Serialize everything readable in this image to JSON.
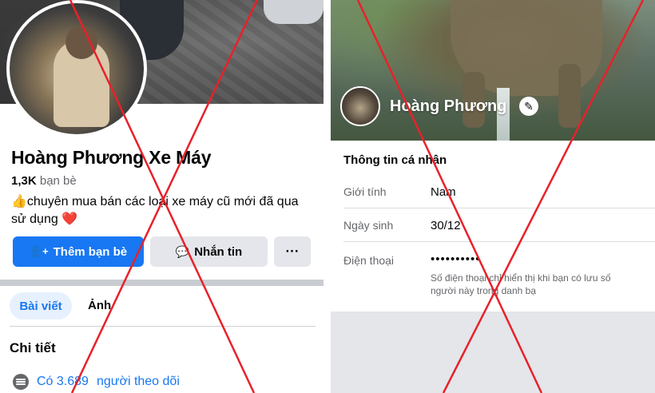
{
  "left_profile": {
    "name": "Hoàng Phương Xe Máy",
    "friends_count": "1,3K",
    "friends_label": "bạn bè",
    "bio_emoji": "👍",
    "bio": "chuyên mua bán các loại xe máy cũ mới đã qua sử dụng",
    "bio_heart": "❤️",
    "add_friend_icon": "👤+",
    "add_friend_label": "Thêm bạn bè",
    "message_icon": "💬",
    "message_label": "Nhắn tin",
    "more_label": "···",
    "tabs": [
      {
        "label": "Bài viết",
        "active": true
      },
      {
        "label": "Ảnh",
        "active": false
      }
    ],
    "details_title": "Chi tiết",
    "followers_prefix": "Có 3.689",
    "followers_suffix": "người theo dõi"
  },
  "right_profile": {
    "name": "Hoàng Phương",
    "edit_icon": "✎",
    "section_title": "Thông tin cá nhân",
    "rows": [
      {
        "label": "Giới tính",
        "value": "Nam"
      },
      {
        "label": "Ngày sinh",
        "value": "30/12"
      },
      {
        "label": "Điện thoại",
        "value": "••••••••••"
      }
    ],
    "phone_note": "Số điện thoại chỉ hiển thị khi bạn có lưu số người này trong danh bạ"
  },
  "colors": {
    "brand_blue": "#1877f2",
    "button_grey": "#e4e6eb",
    "secondary_text": "#65676b",
    "cross_red": "#e8212a"
  }
}
